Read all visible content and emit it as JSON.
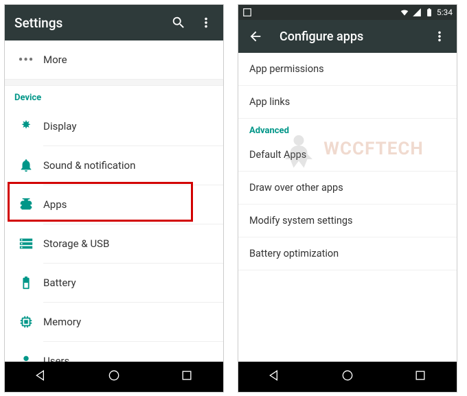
{
  "left": {
    "appbar_title": "Settings",
    "more_label": "More",
    "device_header": "Device",
    "items": [
      {
        "label": "Display"
      },
      {
        "label": "Sound & notification"
      },
      {
        "label": "Apps"
      },
      {
        "label": "Storage & USB"
      },
      {
        "label": "Battery"
      },
      {
        "label": "Memory"
      },
      {
        "label": "Users"
      }
    ]
  },
  "right": {
    "status_time": "5:34",
    "appbar_title": "Configure apps",
    "rows": [
      {
        "label": "App permissions"
      },
      {
        "label": "App links"
      }
    ],
    "advanced_header": "Advanced",
    "advanced_rows": [
      {
        "label": "Default Apps"
      },
      {
        "label": "Draw over other apps"
      },
      {
        "label": "Modify system settings"
      },
      {
        "label": "Battery optimization"
      }
    ]
  },
  "watermark_text": "WCCFTECH",
  "colors": {
    "accent": "#009688",
    "appbar": "#2e3a3a",
    "highlight": "#d20000"
  }
}
